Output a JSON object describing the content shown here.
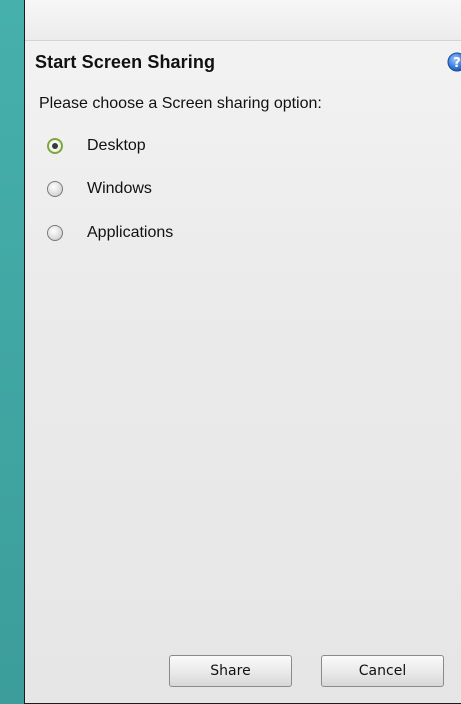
{
  "dialog": {
    "title": "Start Screen Sharing",
    "prompt": "Please choose a Screen sharing option:",
    "options": [
      {
        "label": "Desktop",
        "selected": true
      },
      {
        "label": "Windows",
        "selected": false
      },
      {
        "label": "Applications",
        "selected": false
      }
    ],
    "share_label": "Share",
    "cancel_label": "Cancel"
  },
  "icons": {
    "help": "help-icon"
  },
  "colors": {
    "background": "#3fa7a3",
    "radio_selected_ring": "#79a93d",
    "help_blue": "#2f6fd0"
  }
}
